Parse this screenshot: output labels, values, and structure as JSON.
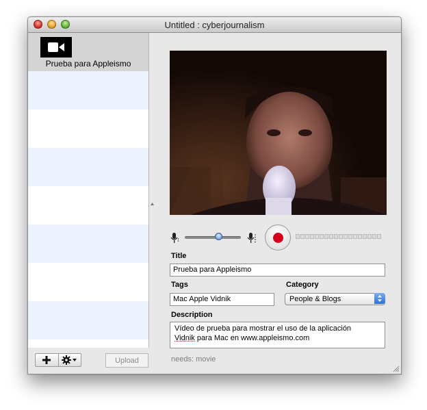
{
  "window": {
    "title": "Untitled : cyberjournalism"
  },
  "sidebar": {
    "items": [
      {
        "label": "Prueba para Appleismo",
        "icon": "video-camera-icon",
        "selected": true
      }
    ]
  },
  "recording": {
    "input_level_fraction": 0.6
  },
  "form": {
    "title_label": "Title",
    "title_value": "Prueba para Appleismo",
    "tags_label": "Tags",
    "tags_value": "Mac Apple Vidnik",
    "category_label": "Category",
    "category_value": "People & Blogs",
    "description_label": "Description",
    "description_line1": "Vídeo de prueba para mostrar el uso de la aplicación",
    "description_line2_word": "Vidnik",
    "description_line2_rest": " para Mac en www.appleismo.com"
  },
  "bottom": {
    "upload_label": "Upload",
    "status_text": "needs: movie"
  },
  "colors": {
    "record_red": "#d6001a",
    "list_stripe": "#edf3fe",
    "selection_gray": "#d4d4d4"
  }
}
